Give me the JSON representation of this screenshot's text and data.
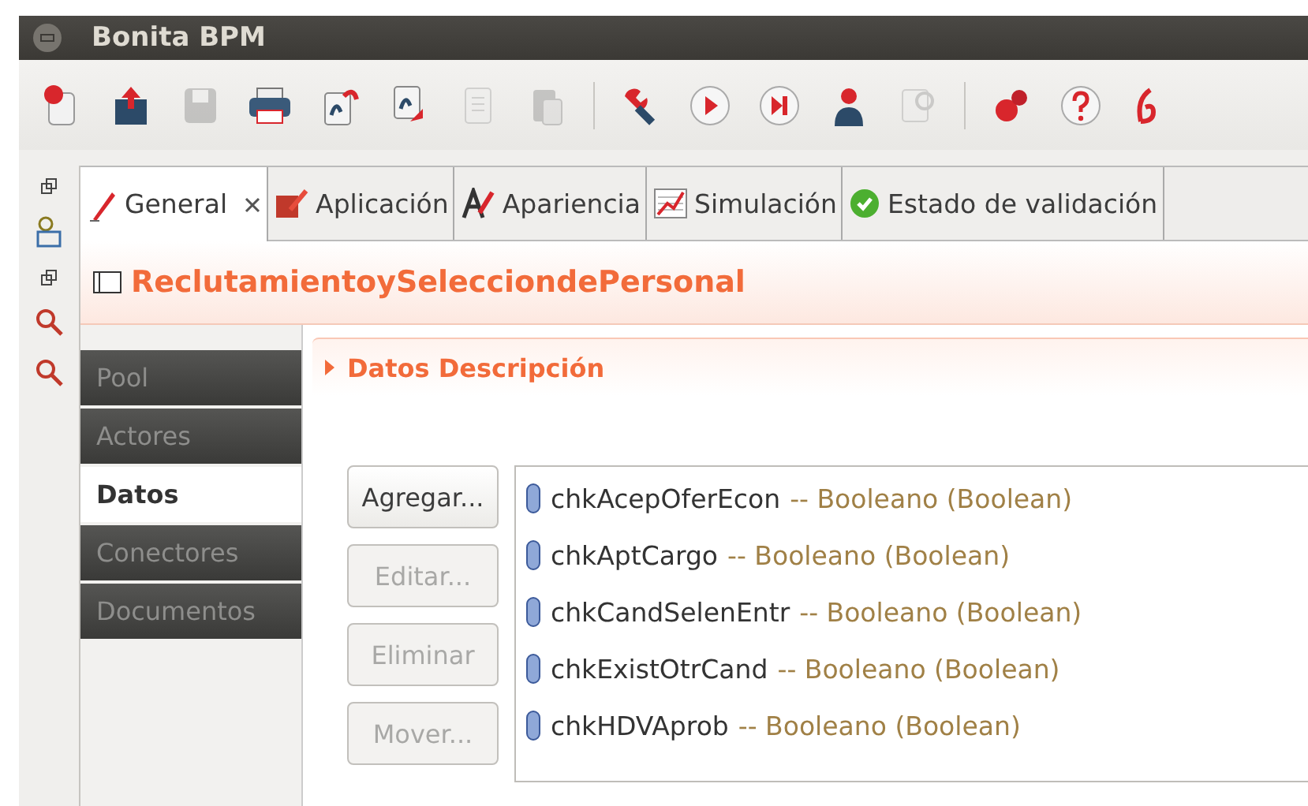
{
  "window": {
    "title": "Bonita BPM"
  },
  "toolbar": [
    {
      "kind": "button",
      "disabled": false
    },
    {
      "kind": "button",
      "disabled": false
    },
    {
      "kind": "button",
      "disabled": true
    },
    {
      "kind": "button",
      "disabled": false
    },
    {
      "kind": "button",
      "disabled": false
    },
    {
      "kind": "button",
      "disabled": false
    },
    {
      "kind": "button",
      "disabled": true
    },
    {
      "kind": "button",
      "disabled": true
    },
    {
      "kind": "separator"
    },
    {
      "kind": "button",
      "disabled": false
    },
    {
      "kind": "button",
      "disabled": false
    },
    {
      "kind": "button",
      "disabled": false
    },
    {
      "kind": "button",
      "disabled": false
    },
    {
      "kind": "button",
      "disabled": true
    },
    {
      "kind": "separator"
    },
    {
      "kind": "button",
      "disabled": false
    },
    {
      "kind": "button",
      "disabled": false
    },
    {
      "kind": "button",
      "disabled": false
    }
  ],
  "tabs": [
    {
      "label": "General",
      "selected": true,
      "closable": true
    },
    {
      "label": "Aplicación",
      "selected": false,
      "closable": false
    },
    {
      "label": "Apariencia",
      "selected": false,
      "closable": false
    },
    {
      "label": "Simulación",
      "selected": false,
      "closable": false
    },
    {
      "label": "Estado de validación",
      "selected": false,
      "closable": false
    }
  ],
  "process_title": "ReclutamientoySelecciondePersonal",
  "side_tabs": [
    {
      "label": "Pool",
      "selected": false
    },
    {
      "label": "Actores",
      "selected": false
    },
    {
      "label": "Datos",
      "selected": true
    },
    {
      "label": "Conectores",
      "selected": false
    },
    {
      "label": "Documentos",
      "selected": false
    }
  ],
  "section": {
    "title": "Datos Descripción",
    "expanded": false
  },
  "buttons": [
    {
      "label": "Agregar...",
      "disabled": false
    },
    {
      "label": "Editar...",
      "disabled": true
    },
    {
      "label": "Eliminar",
      "disabled": true
    },
    {
      "label": "Mover...",
      "disabled": true
    }
  ],
  "variables": [
    {
      "name": "chkAcepOferEcon",
      "type": "-- Booleano (Boolean)"
    },
    {
      "name": "chkAptCargo",
      "type": "-- Booleano (Boolean)"
    },
    {
      "name": "chkCandSelenEntr",
      "type": "-- Booleano (Boolean)"
    },
    {
      "name": "chkExistOtrCand",
      "type": "-- Booleano (Boolean)"
    },
    {
      "name": "chkHDVAprob",
      "type": "-- Booleano (Boolean)"
    }
  ]
}
